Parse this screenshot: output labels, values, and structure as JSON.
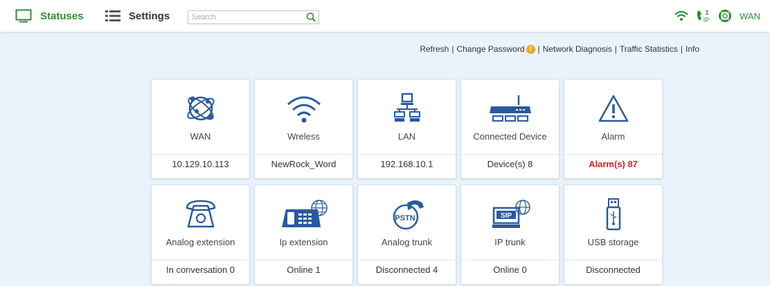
{
  "header": {
    "statuses_label": "Statuses",
    "settings_label": "Settings",
    "search_placeholder": "Search",
    "wan_label": "WAN",
    "ip_badge": "1",
    "ip_text": "IP"
  },
  "links": {
    "refresh": "Refresh",
    "change_password": "Change Password",
    "network_diagnosis": "Network Diagnosis",
    "traffic_statistics": "Traffic Statistics",
    "info": "Info",
    "separator": "|",
    "warning_mark": "!"
  },
  "tiles": [
    {
      "label": "WAN",
      "value": "10.129.10.113",
      "icon": "globe-network-icon"
    },
    {
      "label": "Wreless",
      "value": "NewRock_Word",
      "icon": "wifi-icon"
    },
    {
      "label": "LAN",
      "value": "192.168.10.1",
      "icon": "lan-network-icon"
    },
    {
      "label": "Connected Device",
      "value": "Device(s) 8",
      "icon": "router-icon"
    },
    {
      "label": "Alarm",
      "value": "Alarm(s) 87",
      "icon": "warning-triangle-icon"
    },
    {
      "label": "Analog extension",
      "value": "In conversation 0",
      "icon": "desk-phone-icon"
    },
    {
      "label": "Ip extension",
      "value": "Online 1",
      "icon": "ip-phone-icon"
    },
    {
      "label": "Analog trunk",
      "value": "Disconnected 4",
      "icon": "pstn-icon",
      "icon_text": "PSTN"
    },
    {
      "label": "IP trunk",
      "value": "Online 0",
      "icon": "sip-trunk-icon",
      "icon_text": "SIP"
    },
    {
      "label": "USB storage",
      "value": "Disconnected",
      "icon": "usb-storage-icon"
    }
  ],
  "colors": {
    "accent_green": "#2f8f2f",
    "icon_blue": "#2a5a9e",
    "alarm_red": "#e02020",
    "warning_orange": "#f5a623",
    "background": "#eaf3fc"
  }
}
